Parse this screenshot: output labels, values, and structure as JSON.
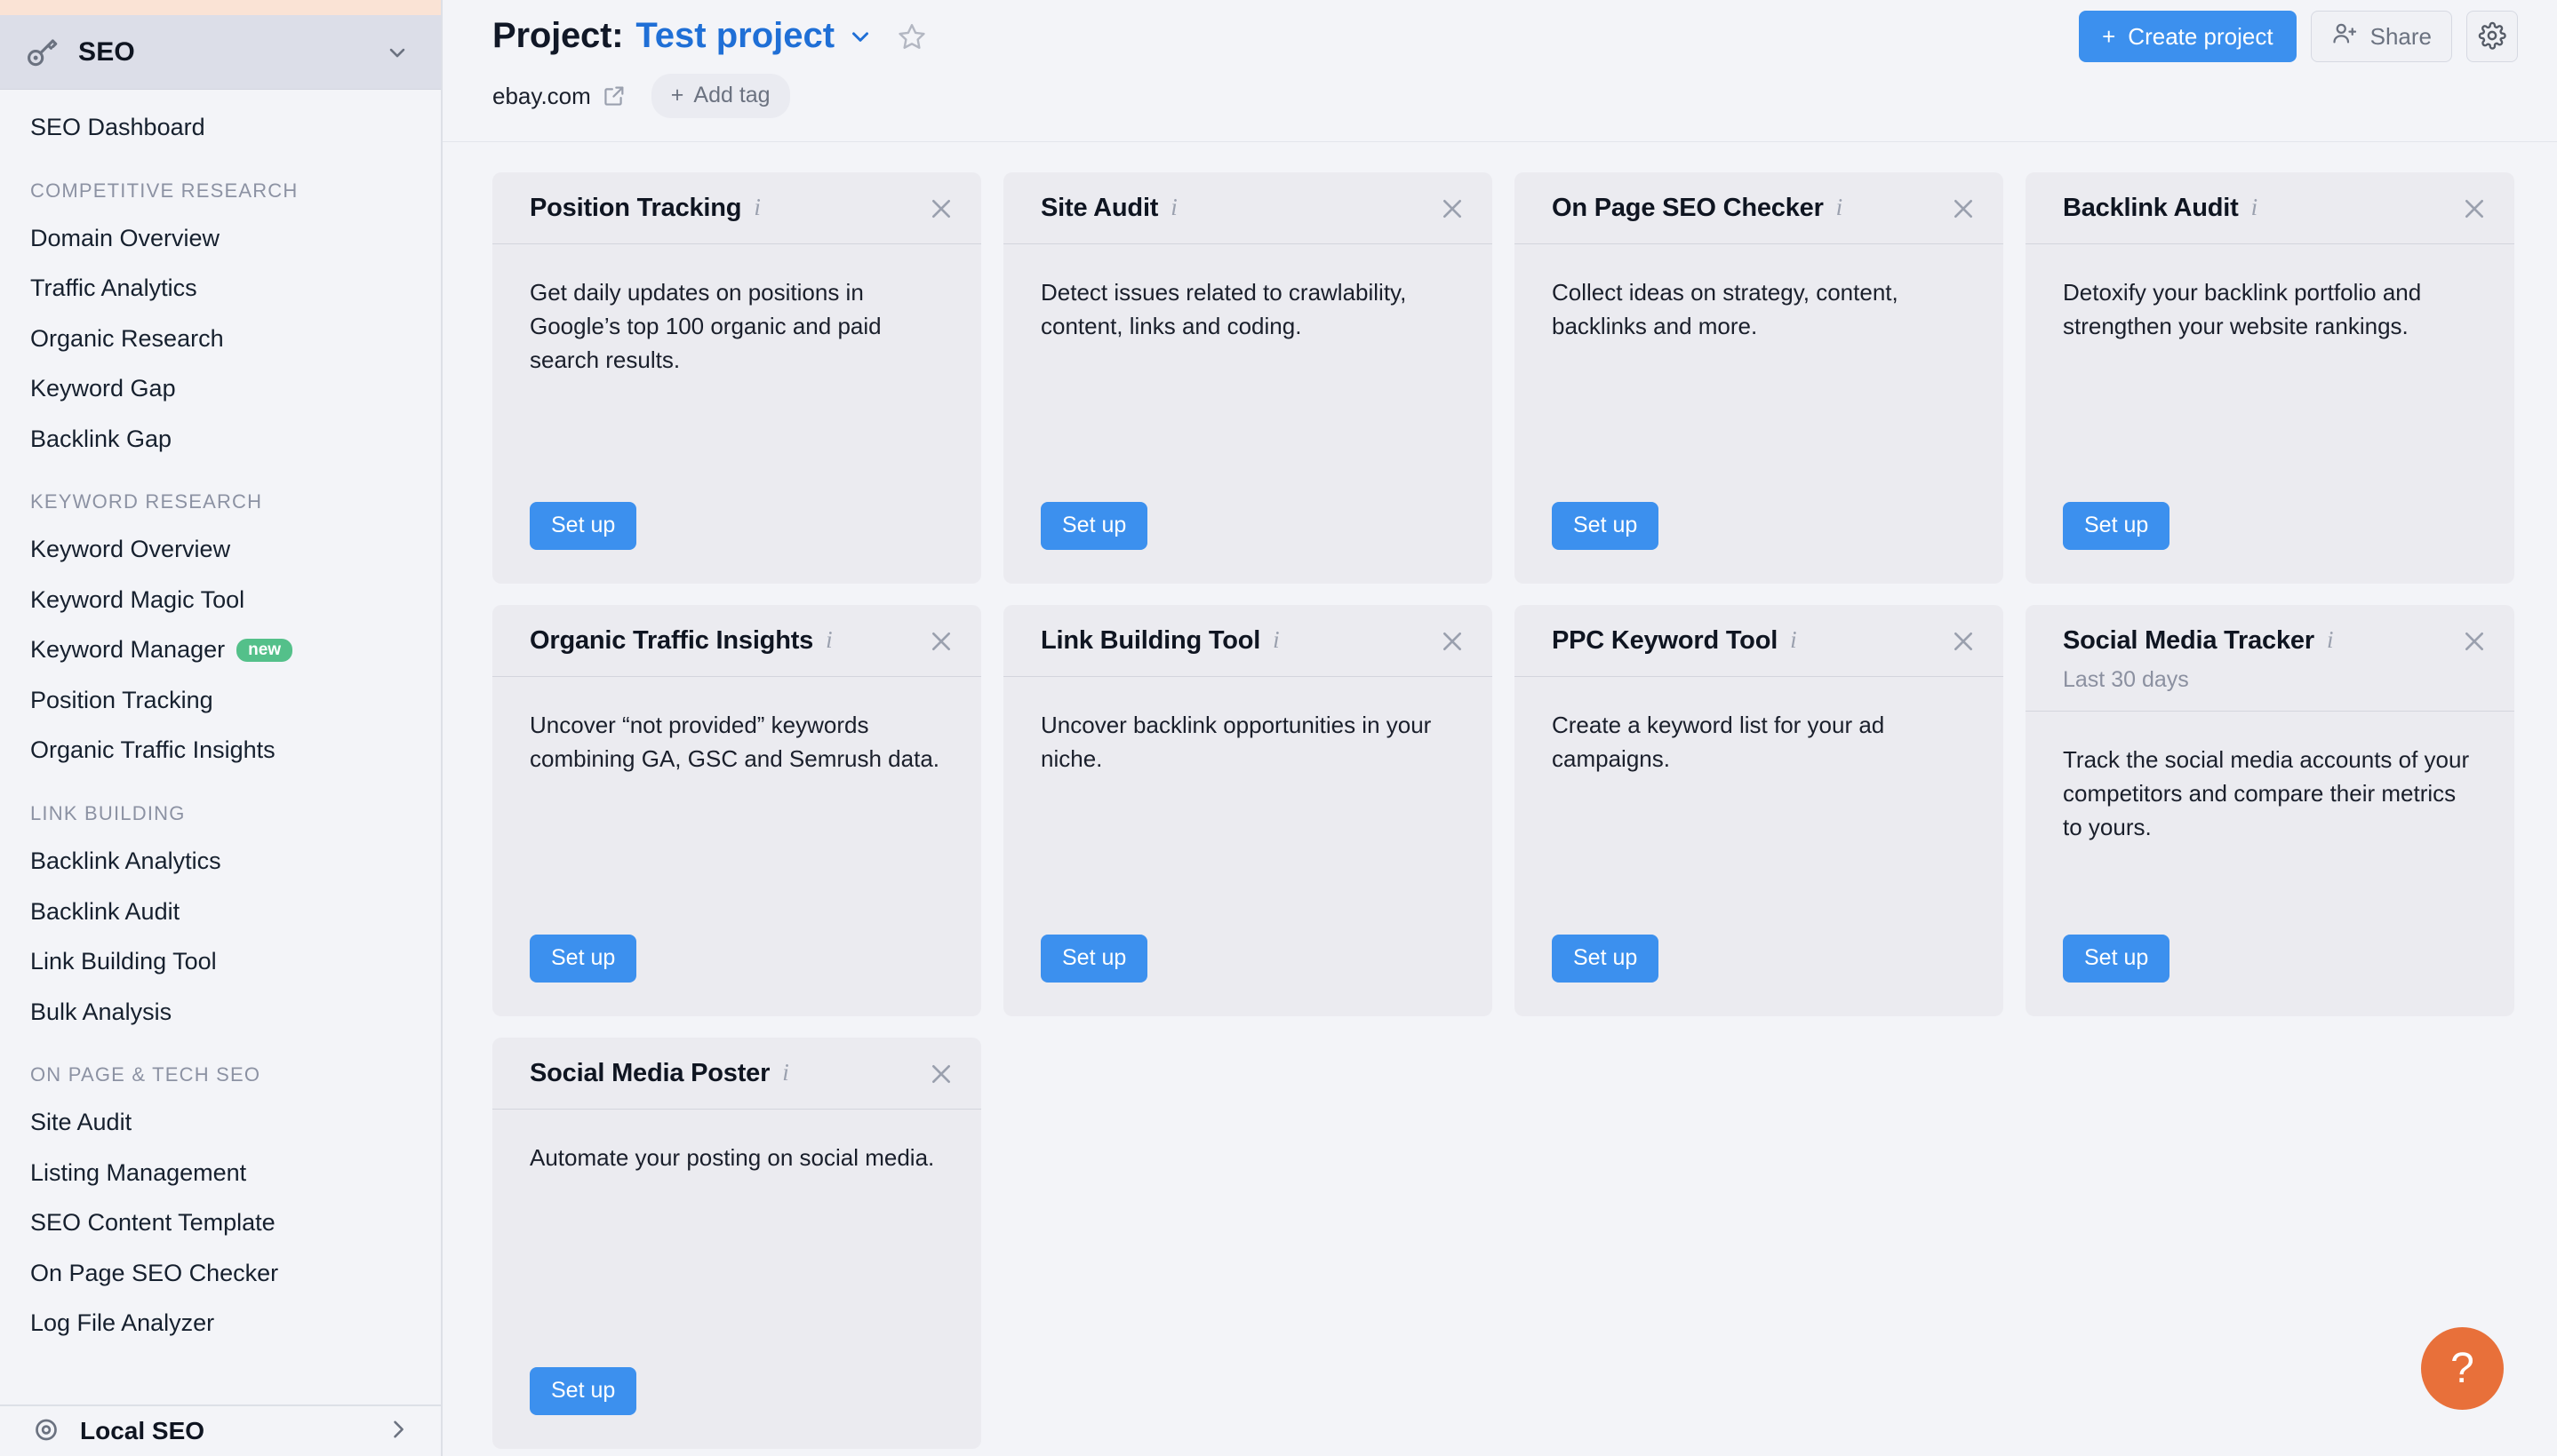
{
  "sidebar": {
    "section_title": "SEO",
    "key_icon": "key-icon",
    "collapse_icon": "chevron-down-icon",
    "dashboard_label": "SEO Dashboard",
    "groups": [
      {
        "label": "COMPETITIVE RESEARCH",
        "items": [
          {
            "label": "Domain Overview"
          },
          {
            "label": "Traffic Analytics"
          },
          {
            "label": "Organic Research"
          },
          {
            "label": "Keyword Gap"
          },
          {
            "label": "Backlink Gap"
          }
        ]
      },
      {
        "label": "KEYWORD RESEARCH",
        "items": [
          {
            "label": "Keyword Overview"
          },
          {
            "label": "Keyword Magic Tool"
          },
          {
            "label": "Keyword Manager",
            "badge": "new"
          },
          {
            "label": "Position Tracking"
          },
          {
            "label": "Organic Traffic Insights"
          }
        ]
      },
      {
        "label": "LINK BUILDING",
        "items": [
          {
            "label": "Backlink Analytics"
          },
          {
            "label": "Backlink Audit"
          },
          {
            "label": "Link Building Tool"
          },
          {
            "label": "Bulk Analysis"
          }
        ]
      },
      {
        "label": "ON PAGE & TECH SEO",
        "items": [
          {
            "label": "Site Audit"
          },
          {
            "label": "Listing Management"
          },
          {
            "label": "SEO Content Template"
          },
          {
            "label": "On Page SEO Checker"
          },
          {
            "label": "Log File Analyzer"
          }
        ]
      }
    ],
    "footer": {
      "label": "Local SEO",
      "icon": "location-pin-icon",
      "chevron": "chevron-right-icon"
    }
  },
  "header": {
    "title_prefix": "Project:",
    "project_name": "Test project",
    "project_chevron_icon": "chevron-down-icon",
    "favorite_icon": "star-icon",
    "domain": "ebay.com",
    "external_link_icon": "external-link-icon",
    "add_tag_label": "Add tag",
    "add_tag_plus": "+",
    "create_project_label": "Create project",
    "create_project_plus": "+",
    "share_label": "Share",
    "share_icon": "user-add-icon",
    "settings_icon": "gear-icon"
  },
  "cards": [
    {
      "title": "Position Tracking",
      "subtitle": "",
      "description": "Get daily updates on positions in Google’s top 100 organic and paid search results.",
      "button": "Set up",
      "info_icon": "info-icon",
      "close_icon": "close-icon"
    },
    {
      "title": "Site Audit",
      "subtitle": "",
      "description": "Detect issues related to crawlability, content, links and coding.",
      "button": "Set up",
      "info_icon": "info-icon",
      "close_icon": "close-icon"
    },
    {
      "title": "On Page SEO Checker",
      "subtitle": "",
      "description": "Collect ideas on strategy, content, backlinks and more.",
      "button": "Set up",
      "info_icon": "info-icon",
      "close_icon": "close-icon"
    },
    {
      "title": "Backlink Audit",
      "subtitle": "",
      "description": "Detoxify your backlink portfolio and strengthen your website rankings.",
      "button": "Set up",
      "info_icon": "info-icon",
      "close_icon": "close-icon"
    },
    {
      "title": "Organic Traffic Insights",
      "subtitle": "",
      "description": "Uncover “not provided” keywords combining GA, GSC and Semrush data.",
      "button": "Set up",
      "info_icon": "info-icon",
      "close_icon": "close-icon"
    },
    {
      "title": "Link Building Tool",
      "subtitle": "",
      "description": "Uncover backlink opportunities in your niche.",
      "button": "Set up",
      "info_icon": "info-icon",
      "close_icon": "close-icon"
    },
    {
      "title": "PPC Keyword Tool",
      "subtitle": "",
      "description": "Create a keyword list for your ad campaigns.",
      "button": "Set up",
      "info_icon": "info-icon",
      "close_icon": "close-icon"
    },
    {
      "title": "Social Media Tracker",
      "subtitle": "Last 30 days",
      "description": "Track the social media accounts of your competitors and compare their metrics to yours.",
      "button": "Set up",
      "info_icon": "info-icon",
      "close_icon": "close-icon"
    },
    {
      "title": "Social Media Poster",
      "subtitle": "",
      "description": "Automate your posting on social media.",
      "button": "Set up",
      "info_icon": "info-icon",
      "close_icon": "close-icon"
    }
  ],
  "help": {
    "label": "?",
    "icon": "question-mark-icon"
  },
  "colors": {
    "accent_blue": "#3C90EE",
    "link_blue": "#1F6FD6",
    "badge_green": "#54C08A",
    "help_orange": "#E8703A",
    "card_bg": "#EBEBF0",
    "page_bg": "#F3F4F8",
    "top_strip": "#FAE3D5",
    "seo_header_bg": "#DCDEE8"
  }
}
